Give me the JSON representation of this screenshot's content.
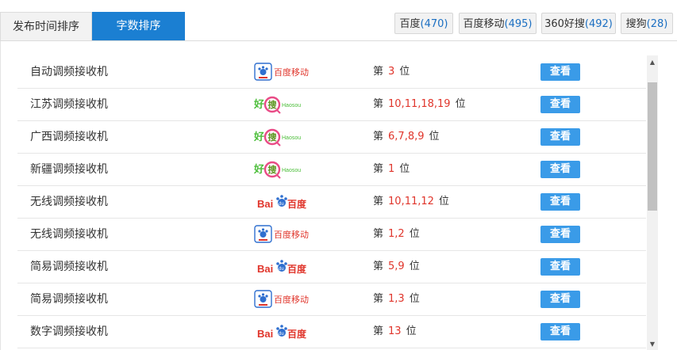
{
  "tabs": [
    {
      "label": "发布时间排序",
      "active": false
    },
    {
      "label": "字数排序",
      "active": true
    }
  ],
  "engines": [
    {
      "name": "百度",
      "count": "(470)"
    },
    {
      "name": "百度移动",
      "count": "(495)"
    },
    {
      "name": "360好搜",
      "count": "(492)"
    },
    {
      "name": "搜狗",
      "count": "(28)"
    }
  ],
  "rank_prefix": "第",
  "rank_suffix": "位",
  "view_label": "查看",
  "logos": {
    "baidu_mobile": "百度移动",
    "haosou_cn": "好",
    "haosou_box": "搜",
    "haosou_en": "Haosou",
    "baidu_bai": "Bai",
    "baidu_du": "du",
    "baidu_cn": "百度"
  },
  "rows": [
    {
      "keyword": "自动调频接收机",
      "engine": "baidu_mobile",
      "rank": "3"
    },
    {
      "keyword": "江苏调频接收机",
      "engine": "haosou",
      "rank": "10,11,18,19"
    },
    {
      "keyword": "广西调频接收机",
      "engine": "haosou",
      "rank": "6,7,8,9"
    },
    {
      "keyword": "新疆调频接收机",
      "engine": "haosou",
      "rank": "1"
    },
    {
      "keyword": "无线调频接收机",
      "engine": "baidu",
      "rank": "10,11,12"
    },
    {
      "keyword": "无线调频接收机",
      "engine": "baidu_mobile",
      "rank": "1,2"
    },
    {
      "keyword": "简易调频接收机",
      "engine": "baidu",
      "rank": "5,9"
    },
    {
      "keyword": "简易调频接收机",
      "engine": "baidu_mobile",
      "rank": "1,3"
    },
    {
      "keyword": "数字调频接收机",
      "engine": "baidu",
      "rank": "13"
    }
  ]
}
